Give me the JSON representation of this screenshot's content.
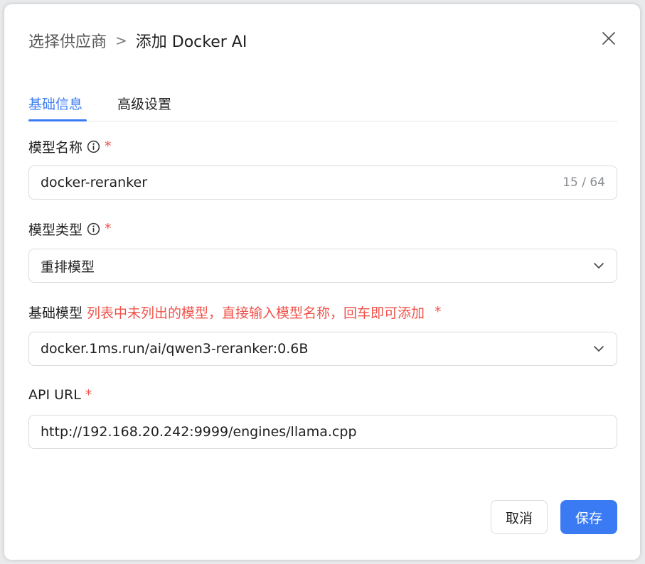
{
  "header": {
    "breadcrumb_prev": "选择供应商",
    "breadcrumb_sep": ">",
    "title": "添加 Docker AI"
  },
  "tabs": [
    {
      "label": "基础信息",
      "active": true
    },
    {
      "label": "高级设置",
      "active": false
    }
  ],
  "form": {
    "model_name": {
      "label": "模型名称",
      "required_mark": "*",
      "value": "docker-reranker",
      "counter": "15 / 64"
    },
    "model_type": {
      "label": "模型类型",
      "required_mark": "*",
      "value": "重排模型"
    },
    "base_model": {
      "label": "基础模型",
      "hint": "列表中未列出的模型，直接输入模型名称，回车即可添加",
      "required_mark": "*",
      "value": "docker.1ms.run/ai/qwen3-reranker:0.6B"
    },
    "api_url": {
      "label": "API URL",
      "required_mark": "*",
      "value": "http://192.168.20.242:9999/engines/llama.cpp"
    }
  },
  "footer": {
    "cancel_label": "取消",
    "save_label": "保存"
  },
  "icons": {
    "close": "close-icon",
    "info": "info-icon",
    "dropdown": "chevron-down-icon"
  },
  "colors": {
    "accent": "#3a7bf4",
    "required": "#f0524a",
    "border": "#d9dbdf"
  }
}
